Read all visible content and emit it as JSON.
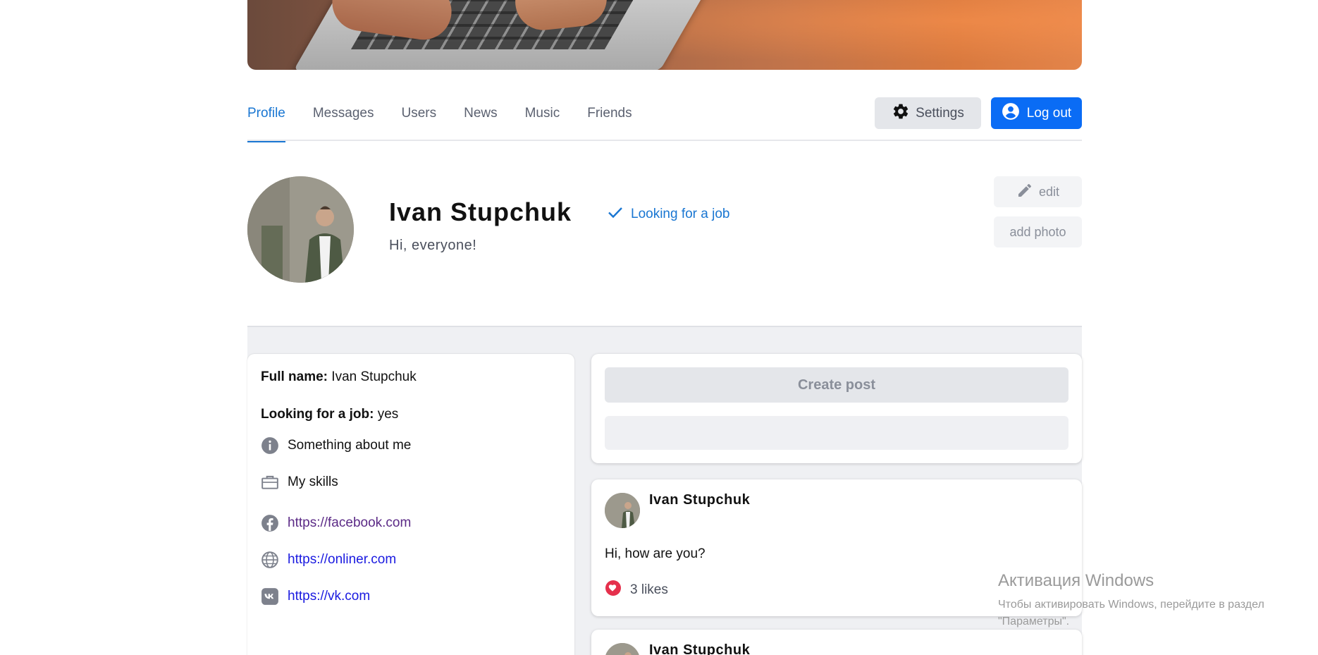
{
  "nav": {
    "tabs": [
      {
        "label": "Profile",
        "active": true
      },
      {
        "label": "Messages",
        "active": false
      },
      {
        "label": "Users",
        "active": false
      },
      {
        "label": "News",
        "active": false
      },
      {
        "label": "Music",
        "active": false
      },
      {
        "label": "Friends",
        "active": false
      }
    ],
    "settings_label": "Settings",
    "logout_label": "Log out"
  },
  "profile": {
    "name": "Ivan Stupchuk",
    "status": "Hi, everyone!",
    "job_label": "Looking for a job",
    "edit_label": "edit",
    "add_photo_label": "add photo"
  },
  "info": {
    "full_name_key": "Full name:",
    "full_name_value": "Ivan Stupchuk",
    "job_key": "Looking for a job:",
    "job_value": "yes",
    "about_label": "Something about me",
    "skills_label": "My skills",
    "links": [
      {
        "icon": "facebook-icon",
        "url": "https://facebook.com"
      },
      {
        "icon": "globe-icon",
        "url": "https://onliner.com"
      },
      {
        "icon": "vk-icon",
        "url": "https://vk.com"
      }
    ]
  },
  "create_post": {
    "button_label": "Create post",
    "input_placeholder": ""
  },
  "posts": [
    {
      "author": "Ivan Stupchuk",
      "text": "Hi, how are you?",
      "likes": "3 likes"
    },
    {
      "author": "Ivan Stupchuk"
    }
  ],
  "watermark": {
    "title": "Активация Windows",
    "subtitle": "Чтобы активировать Windows, перейдите в раздел \"Параметры\"."
  },
  "colors": {
    "accent": "#1976d2",
    "primary_button": "#0a6cf5",
    "like": "#e5304c"
  }
}
